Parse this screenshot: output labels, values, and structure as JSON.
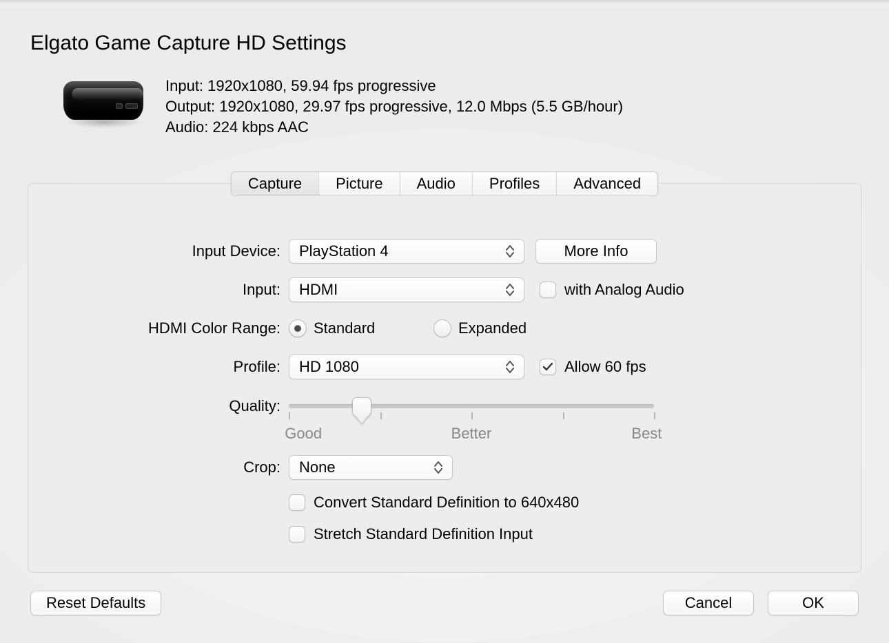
{
  "title": "Elgato Game Capture HD Settings",
  "summary": {
    "input": "Input: 1920x1080, 59.94 fps progressive",
    "output": "Output: 1920x1080, 29.97 fps progressive, 12.0 Mbps (5.5 GB/hour)",
    "audio": "Audio: 224 kbps AAC"
  },
  "tabs": [
    "Capture",
    "Picture",
    "Audio",
    "Profiles",
    "Advanced"
  ],
  "active_tab": 0,
  "labels": {
    "input_device": "Input Device:",
    "input": "Input:",
    "hdmi_color_range": "HDMI Color Range:",
    "profile": "Profile:",
    "quality": "Quality:",
    "crop": "Crop:"
  },
  "input_device": {
    "value": "PlayStation 4",
    "more_info": "More Info"
  },
  "input": {
    "value": "HDMI",
    "analog_checkbox": "with Analog Audio",
    "analog_checked": false
  },
  "color_range": {
    "options": [
      "Standard",
      "Expanded"
    ],
    "selected": 0
  },
  "profile": {
    "value": "HD 1080",
    "allow60_label": "Allow 60 fps",
    "allow60_checked": true
  },
  "quality": {
    "labels": [
      "Good",
      "Better",
      "Best"
    ],
    "position_pct": 20
  },
  "crop": {
    "value": "None"
  },
  "extras": {
    "convert_sd": "Convert Standard Definition to 640x480",
    "convert_sd_checked": false,
    "stretch_sd": "Stretch Standard Definition Input",
    "stretch_sd_checked": false
  },
  "footer": {
    "reset": "Reset Defaults",
    "cancel": "Cancel",
    "ok": "OK"
  }
}
